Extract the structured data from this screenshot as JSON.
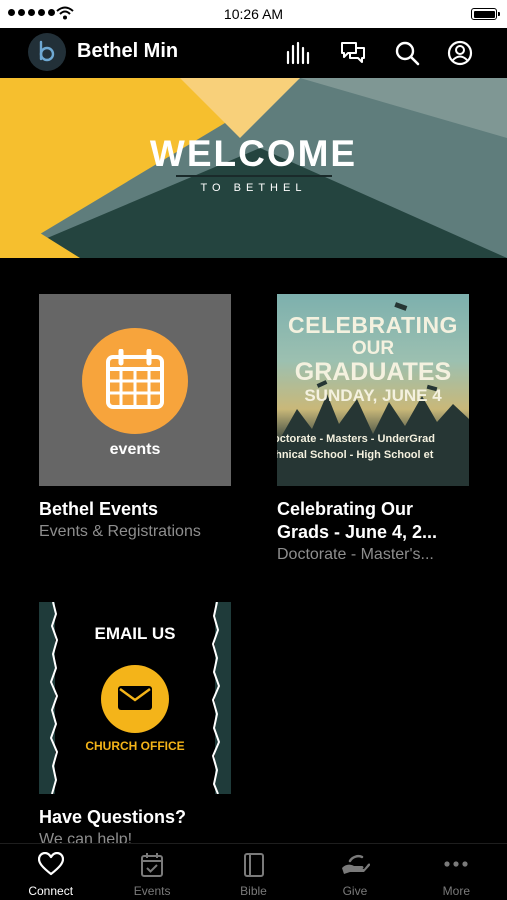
{
  "status_bar": {
    "time": "10:26 AM"
  },
  "header": {
    "app_title": "Bethel Min",
    "logo_letter": "b",
    "icons": [
      "audio-icon",
      "chat-icon",
      "search-icon",
      "profile-icon"
    ]
  },
  "hero": {
    "title": "WELCOME",
    "subtitle": "TO BETHEL",
    "colors": {
      "yellow": "#f6bf2e",
      "teal": "#5f7d7c",
      "dark_teal": "#24443f"
    }
  },
  "cards": [
    {
      "title": "Bethel Events",
      "subtitle": "Events & Registrations",
      "image_label": "events"
    },
    {
      "title": "Celebrating Our",
      "title_line2": "Grads - June 4, 2...",
      "subtitle": "Doctorate - Master's...",
      "image_text": {
        "line1": "CELEBRATING",
        "line2": "OUR",
        "line3": "GRADUATES",
        "line4": "SUNDAY, JUNE 4",
        "degrees1": "octorate - Masters - UnderGrad",
        "degrees2": "chnical School - High School et"
      }
    },
    {
      "title": "Have Questions?",
      "subtitle": "We can help!",
      "image_text": {
        "heading": "EMAIL US",
        "label": "CHURCH OFFICE"
      }
    }
  ],
  "tab_bar": {
    "tabs": [
      {
        "label": "Connect",
        "icon": "heart-icon",
        "active": true
      },
      {
        "label": "Events",
        "icon": "calendar-icon",
        "active": false
      },
      {
        "label": "Bible",
        "icon": "book-icon",
        "active": false
      },
      {
        "label": "Give",
        "icon": "give-hand-icon",
        "active": false
      },
      {
        "label": "More",
        "icon": "more-dots-icon",
        "active": false
      }
    ]
  }
}
